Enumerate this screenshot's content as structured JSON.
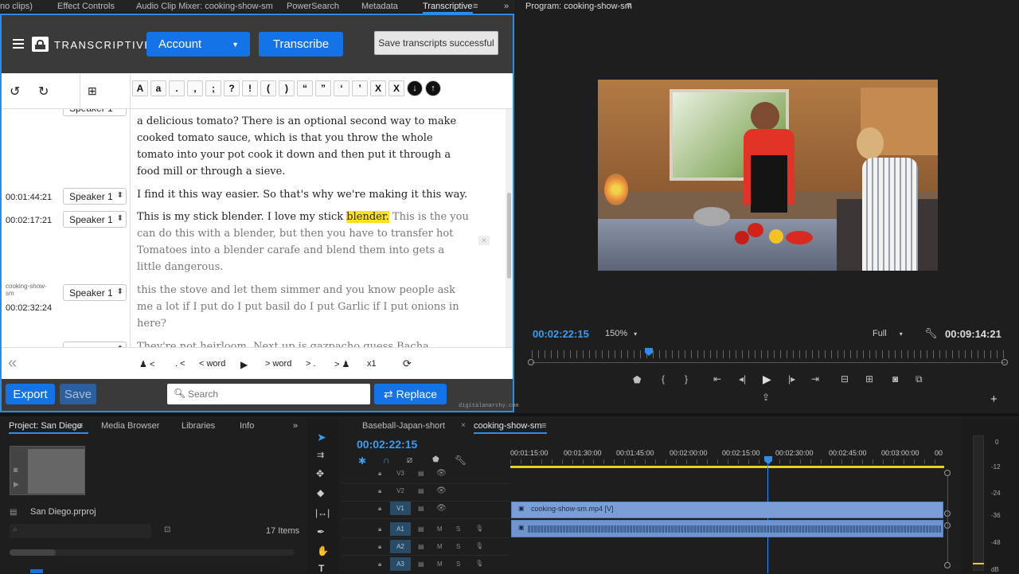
{
  "top_tabs": [
    "no clips)",
    "Effect Controls",
    "Audio Clip Mixer: cooking-show-sm",
    "PowerSearch",
    "Metadata",
    "Transcriptive"
  ],
  "transcriptive": {
    "logo": "TRANSCRIPTIVE",
    "account_label": "Account",
    "transcribe_label": "Transcribe",
    "toast": "Save transcripts successful",
    "punct": [
      "A",
      "a",
      ".",
      ",",
      ";",
      "?",
      "!",
      "(",
      ")",
      "“",
      "”",
      "‘",
      "’",
      "X",
      "X"
    ],
    "rows": [
      {
        "tc": "",
        "speaker": "Speaker 1",
        "text_main": "a delicious tomato? There is an optional second way to make cooked tomato sauce, which is that you throw the whole tomato into your pot cook it down and then put it through a food mill or through a sieve.",
        "hl": "",
        "text_dim": ""
      },
      {
        "tc": "00:01:44:21",
        "speaker": "Speaker 1",
        "text_main": "I find it this way easier. So that's why we're making it this way.",
        "hl": "",
        "text_dim": ""
      },
      {
        "tc": "00:02:17:21",
        "speaker": "Speaker 1",
        "text_main": "This is my stick blender. I love my stick ",
        "hl": "blender.",
        "text_dim": " This is the you can do this with a blender, but then you have to transfer hot Tomatoes into a blender carafe and blend them into gets a little dangerous."
      },
      {
        "tc": "00:02:32:24",
        "clip": "cooking-show-sm",
        "speaker": "Speaker 1",
        "text_main": "",
        "hl": "",
        "text_dim": "this the stove and let them simmer and you know people ask me a lot if I put do I put basil do I put Garlic if I put onions in here?"
      },
      {
        "tc": "",
        "speaker": "",
        "text_main": "",
        "hl": "",
        "text_dim": "They're not heirloom. Next up is gazpacho guess Bacha"
      }
    ],
    "nav": {
      "prev_speaker": "<",
      "prev_sentence": ". <",
      "prev_word": "< word",
      "next_word": "> word",
      "next_sentence": "> .",
      "next_speaker": ">",
      "speed": "x1"
    },
    "export_label": "Export",
    "save_label": "Save",
    "search_placeholder": "Search",
    "replace_label": "Replace",
    "watermark": "digitalanarchy.com"
  },
  "program": {
    "title": "Program: cooking-show-sm",
    "timecode": "00:02:22:15",
    "zoom": "150%",
    "quality": "Full",
    "duration": "00:09:14:21"
  },
  "project": {
    "tabs": [
      "Project: San Diego",
      "Media Browser",
      "Libraries",
      "Info"
    ],
    "file": "San Diego.prproj",
    "items": "17 Items"
  },
  "timeline": {
    "tabs": [
      "Baseball-Japan-short",
      "cooking-show-sm"
    ],
    "timecode": "00:02:22:15",
    "ruler": [
      "00:01:15:00",
      "00:01:30:00",
      "00:01:45:00",
      "00:02:00:00",
      "00:02:15:00",
      "00:02:30:00",
      "00:02:45:00",
      "00:03:00:00",
      "00"
    ],
    "video_tracks": [
      "V3",
      "V2",
      "V1"
    ],
    "audio_tracks": [
      "A1",
      "A2",
      "A3"
    ],
    "clip_label": "cooking-show-sm.mp4 [V]",
    "meter": [
      "0",
      "-12",
      "-24",
      "-36",
      "-48",
      "dB"
    ]
  }
}
